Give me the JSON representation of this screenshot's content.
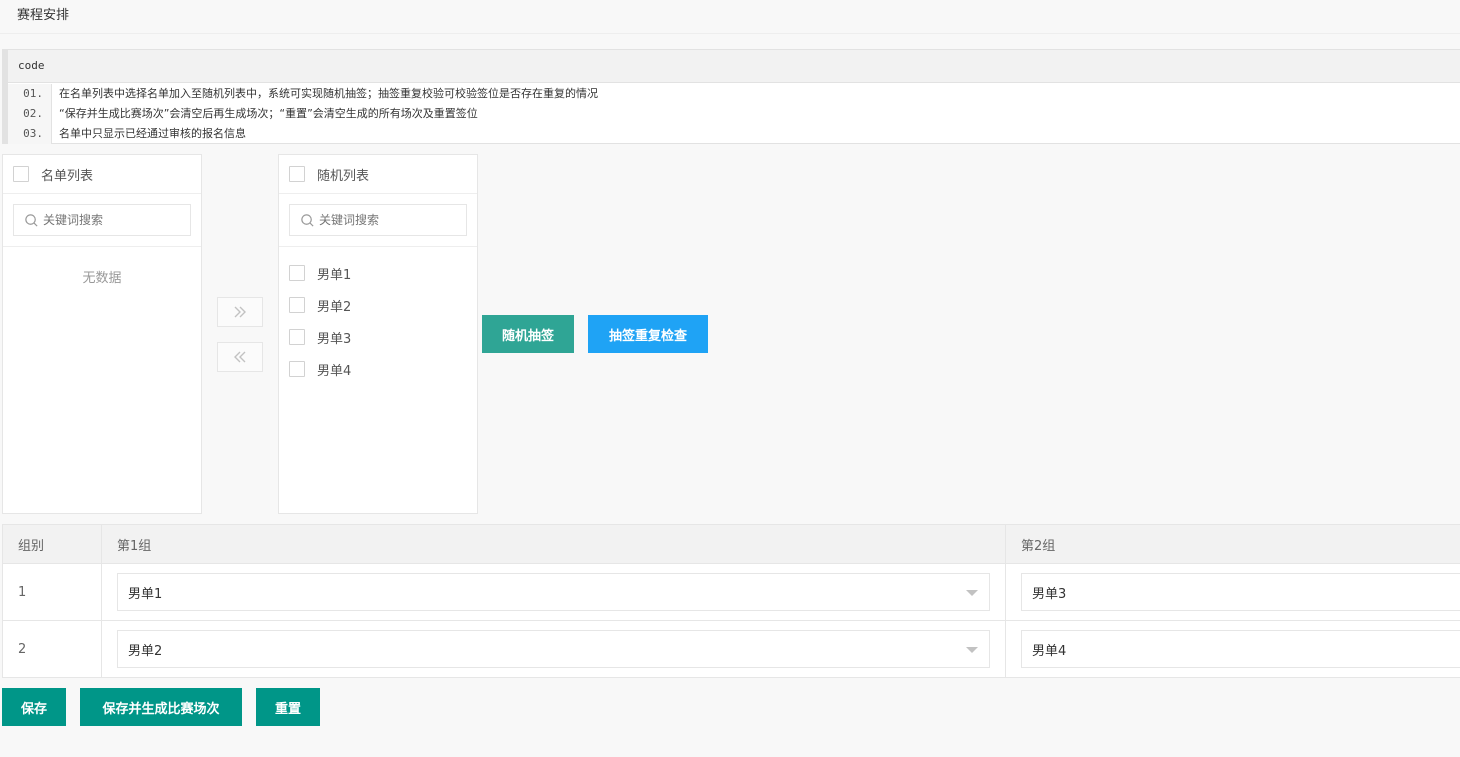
{
  "page": {
    "title": "赛程安排"
  },
  "code": {
    "header": "code",
    "lines": [
      {
        "no": "01.",
        "text": "在名单列表中选择名单加入至随机列表中，系统可实现随机抽签；抽签重复校验可校验签位是否存在重复的情况"
      },
      {
        "no": "02.",
        "text": "“保存并生成比赛场次”会清空后再生成场次；“重置”会清空生成的所有场次及重置签位"
      },
      {
        "no": "03.",
        "text": "名单中只显示已经通过审核的报名信息"
      }
    ]
  },
  "transfer": {
    "left": {
      "title": "名单列表",
      "search_placeholder": "关键词搜索",
      "empty_text": "无数据"
    },
    "right": {
      "title": "随机列表",
      "search_placeholder": "关键词搜索",
      "items": [
        "男单1",
        "男单2",
        "男单3",
        "男单4"
      ]
    },
    "to_right_glyph": "»",
    "to_left_glyph": "«"
  },
  "actions": {
    "draw_label": "随机抽签",
    "check_label": "抽签重复检查"
  },
  "groups": {
    "headers": [
      "组别",
      "第1组",
      "第2组"
    ],
    "rows": [
      {
        "no": "1",
        "g1": "男单1",
        "g2": "男单3"
      },
      {
        "no": "2",
        "g1": "男单2",
        "g2": "男单4"
      }
    ]
  },
  "footer": {
    "save_label": "保存",
    "save_gen_label": "保存并生成比赛场次",
    "reset_label": "重置"
  },
  "colors": {
    "teal": "#009688",
    "draw": "#2fa595",
    "blue": "#1fa3f5"
  },
  "icons": {
    "search": "search-icon",
    "right": "double-chevron-right-icon",
    "left": "double-chevron-left-icon",
    "caret": "caret-down-icon"
  }
}
